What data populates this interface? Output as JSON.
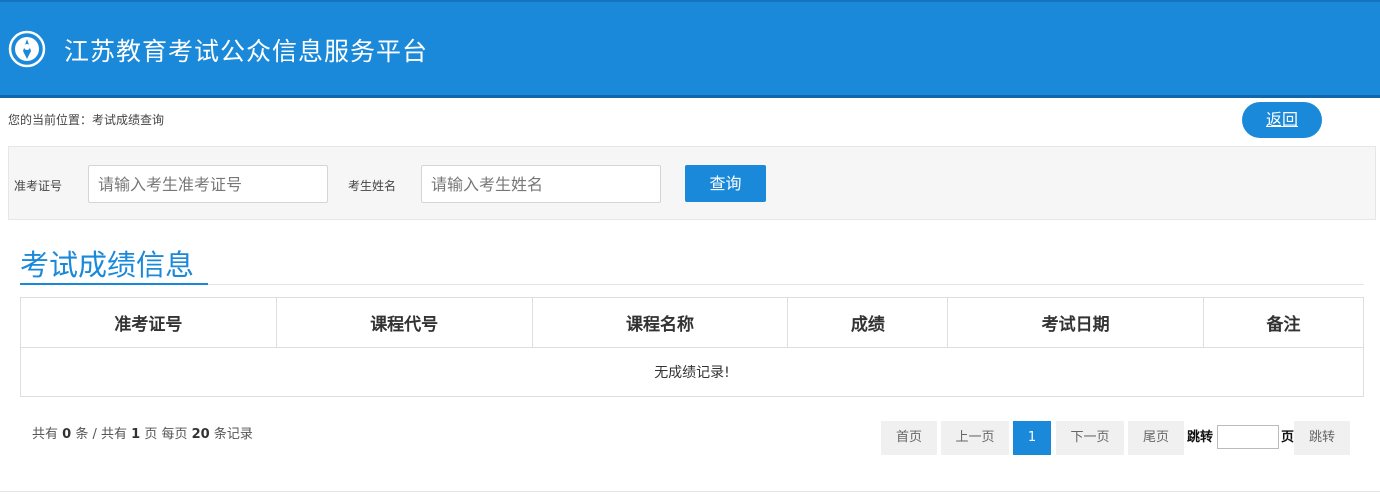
{
  "header": {
    "site_title": "江苏教育考试公众信息服务平台",
    "logo_icon": "emblem-icon"
  },
  "breadcrumb": {
    "text": "您的当前位置：考试成绩查询"
  },
  "back_button": {
    "label": "返回"
  },
  "search": {
    "ticket_label": "准考证号",
    "ticket_placeholder": "请输入考生准考证号",
    "name_label": "考生姓名",
    "name_placeholder": "请输入考生姓名",
    "query_label": "查询"
  },
  "section": {
    "title": "考试成绩信息"
  },
  "table": {
    "columns": [
      "准考证号",
      "课程代号",
      "课程名称",
      "成绩",
      "考试日期",
      "备注"
    ],
    "empty_message": "无成绩记录!"
  },
  "summary": {
    "prefix": "共有",
    "total": "0",
    "unit1": "条 / 共有",
    "pages": "1",
    "unit2": "页 每页",
    "per_page": "20",
    "unit3": "条记录"
  },
  "pager": {
    "first": "首页",
    "prev": "上一页",
    "current": "1",
    "next": "下一页",
    "last": "尾页",
    "jump_prefix": "跳转",
    "jump_suffix": "页",
    "jump_button": "跳转"
  },
  "colors": {
    "brand": "#1b89d9",
    "header_border": "#1066aa"
  }
}
